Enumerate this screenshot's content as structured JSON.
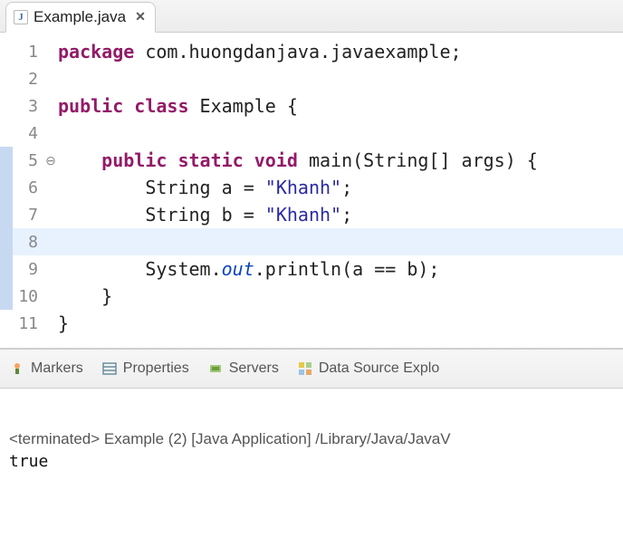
{
  "tab": {
    "filename": "Example.java"
  },
  "code": [
    {
      "n": 1,
      "strip": false,
      "fold": "",
      "hl": false,
      "tokens": [
        [
          "kw",
          "package"
        ],
        [
          "",
          " com.huongdanjava.javaexample;"
        ]
      ]
    },
    {
      "n": 2,
      "strip": false,
      "fold": "",
      "hl": false,
      "tokens": [
        [
          "",
          ""
        ]
      ]
    },
    {
      "n": 3,
      "strip": false,
      "fold": "",
      "hl": false,
      "tokens": [
        [
          "kw",
          "public"
        ],
        [
          "",
          " "
        ],
        [
          "kw",
          "class"
        ],
        [
          "",
          " Example {"
        ]
      ]
    },
    {
      "n": 4,
      "strip": false,
      "fold": "",
      "hl": false,
      "tokens": [
        [
          "",
          ""
        ]
      ]
    },
    {
      "n": 5,
      "strip": true,
      "fold": "⊖",
      "hl": false,
      "tokens": [
        [
          "",
          "    "
        ],
        [
          "kw",
          "public"
        ],
        [
          "",
          " "
        ],
        [
          "kw",
          "static"
        ],
        [
          "",
          " "
        ],
        [
          "kw",
          "void"
        ],
        [
          "",
          " main(String[] args) {"
        ]
      ]
    },
    {
      "n": 6,
      "strip": true,
      "fold": "",
      "hl": false,
      "tokens": [
        [
          "",
          "        String a = "
        ],
        [
          "str",
          "\"Khanh\""
        ],
        [
          "",
          ";"
        ]
      ]
    },
    {
      "n": 7,
      "strip": true,
      "fold": "",
      "hl": false,
      "tokens": [
        [
          "",
          "        String b = "
        ],
        [
          "str",
          "\"Khanh\""
        ],
        [
          "",
          ";"
        ]
      ]
    },
    {
      "n": 8,
      "strip": true,
      "fold": "",
      "hl": true,
      "tokens": [
        [
          "",
          ""
        ]
      ]
    },
    {
      "n": 9,
      "strip": true,
      "fold": "",
      "hl": false,
      "tokens": [
        [
          "",
          "        System."
        ],
        [
          "field",
          "out"
        ],
        [
          "",
          ".println(a == b);"
        ]
      ]
    },
    {
      "n": 10,
      "strip": true,
      "fold": "",
      "hl": false,
      "tokens": [
        [
          "",
          "    }"
        ]
      ]
    },
    {
      "n": 11,
      "strip": false,
      "fold": "",
      "hl": false,
      "tokens": [
        [
          "",
          "}"
        ]
      ]
    }
  ],
  "panelTabs": [
    "Markers",
    "Properties",
    "Servers",
    "Data Source Explo"
  ],
  "console": {
    "status": "<terminated> Example (2) [Java Application] /Library/Java/JavaV",
    "output": "true"
  }
}
